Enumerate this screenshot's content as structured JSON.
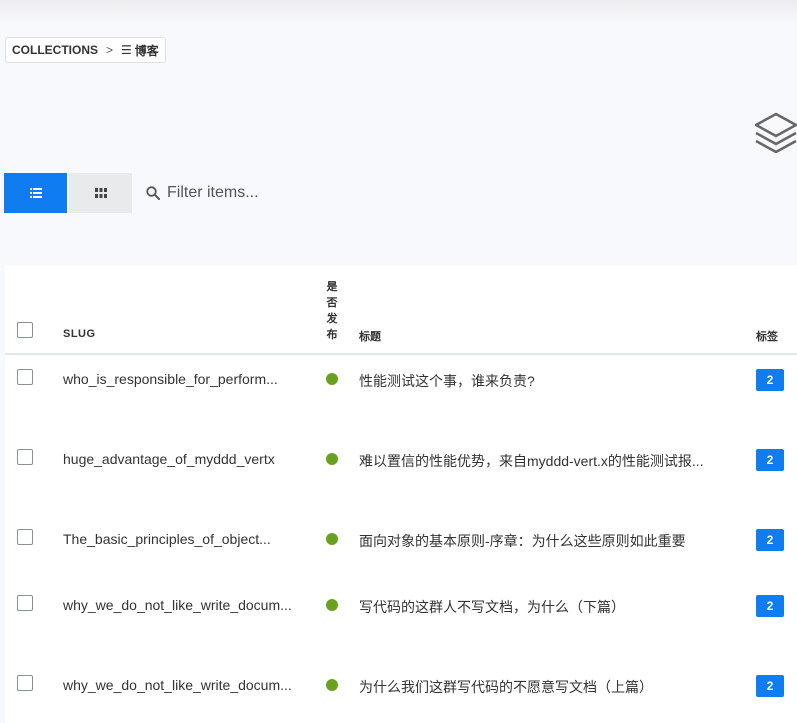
{
  "breadcrumb": {
    "root": "COLLECTIONS",
    "separator": ">",
    "current": "博客"
  },
  "toolbar": {
    "list_view_icon": "list-icon",
    "grid_view_icon": "grid-icon",
    "filter_placeholder": "Filter items..."
  },
  "header_icon": "layers-icon",
  "colors": {
    "accent": "#0f7cf0",
    "published": "#6aa121"
  },
  "table": {
    "columns": {
      "slug": "SLUG",
      "published": "是否发布",
      "title": "标题",
      "tags": "标签"
    },
    "rows": [
      {
        "slug": "who_is_responsible_for_perform...",
        "published": true,
        "title": "性能测试这个事，谁来负责?",
        "tags": "2"
      },
      {
        "slug": "huge_advantage_of_myddd_vertx",
        "published": true,
        "title": "难以置信的性能优势，来自myddd-vert.x的性能测试报...",
        "tags": "2"
      },
      {
        "slug": "The_basic_principles_of_object...",
        "published": true,
        "title": "面向对象的基本原则-序章：为什么这些原则如此重要",
        "tags": "2"
      },
      {
        "slug": "why_we_do_not_like_write_docum...",
        "published": true,
        "title": "写代码的这群人不写文档，为什么（下篇）",
        "tags": "2"
      },
      {
        "slug": "why_we_do_not_like_write_docum...",
        "published": true,
        "title": "为什么我们这群写代码的不愿意写文档（上篇）",
        "tags": "2"
      }
    ]
  }
}
